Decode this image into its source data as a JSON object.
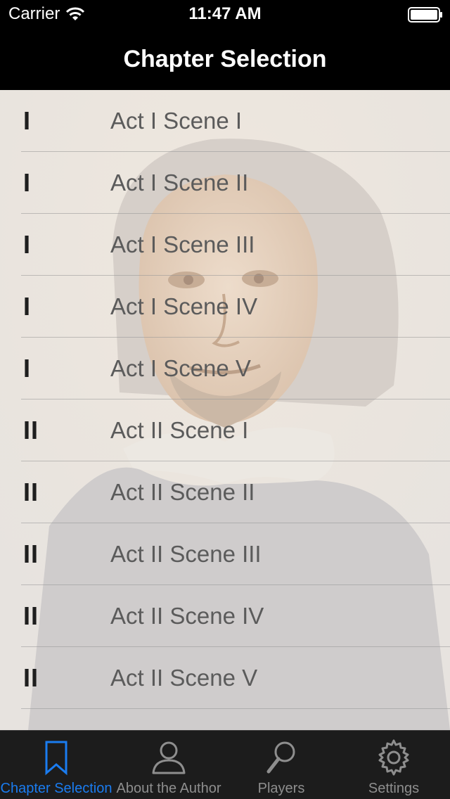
{
  "status_bar": {
    "carrier": "Carrier",
    "time": "11:47 AM",
    "wifi_icon": "wifi-icon",
    "battery_icon": "battery-icon"
  },
  "nav": {
    "title": "Chapter Selection"
  },
  "background_image": "portrait-of-shakespeare",
  "chapters": [
    {
      "act": "I",
      "scene": "Act I Scene I"
    },
    {
      "act": "I",
      "scene": "Act I Scene II"
    },
    {
      "act": "I",
      "scene": "Act I Scene III"
    },
    {
      "act": "I",
      "scene": "Act I Scene IV"
    },
    {
      "act": "I",
      "scene": "Act I Scene V"
    },
    {
      "act": "II",
      "scene": "Act II Scene I"
    },
    {
      "act": "II",
      "scene": "Act II Scene II"
    },
    {
      "act": "II",
      "scene": "Act II Scene III"
    },
    {
      "act": "II",
      "scene": "Act II Scene IV"
    },
    {
      "act": "II",
      "scene": "Act II Scene V"
    }
  ],
  "tabs": [
    {
      "label": "Chapter Selection",
      "icon": "bookmark-icon",
      "active": true
    },
    {
      "label": "About the Author",
      "icon": "person-icon",
      "active": false
    },
    {
      "label": "Players",
      "icon": "magnifier-icon",
      "active": false
    },
    {
      "label": "Settings",
      "icon": "gear-icon",
      "active": false
    }
  ],
  "colors": {
    "accent": "#1a7cf0",
    "tab_inactive": "#8e8e8e",
    "bar_background": "#000000"
  }
}
